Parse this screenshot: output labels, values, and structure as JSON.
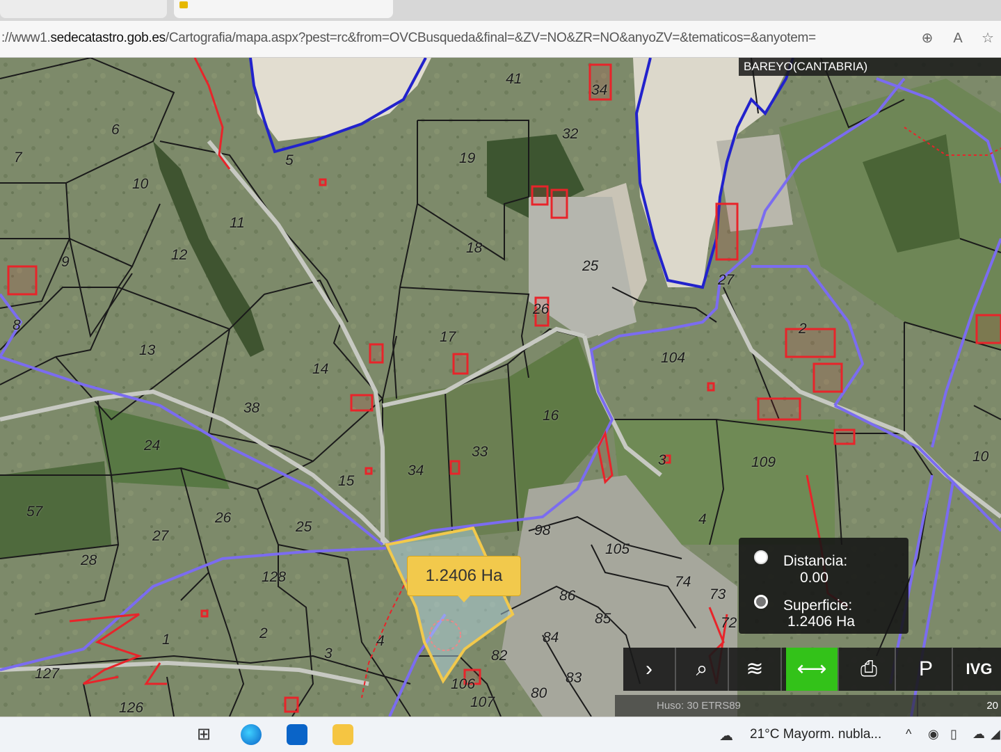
{
  "browser": {
    "url_prefix": "://www1.",
    "url_host": "sedecatastro.gob.es",
    "url_path": "/Cartografia/mapa.aspx?pest=rc&from=OVCBusqueda&final=&ZV=NO&ZR=NO&anyoZV=&tematicos=&anyotem="
  },
  "map": {
    "place_name": "BAREYO(CANTABRIA)",
    "selected_area": "1.2406 Ha",
    "parcels": [
      {
        "id": "p41",
        "text": "41"
      },
      {
        "id": "p34a",
        "text": "34"
      },
      {
        "id": "p6",
        "text": "6"
      },
      {
        "id": "p7",
        "text": "7"
      },
      {
        "id": "p10a",
        "text": "10"
      },
      {
        "id": "p32",
        "text": "32"
      },
      {
        "id": "p19",
        "text": "19"
      },
      {
        "id": "p5",
        "text": "5"
      },
      {
        "id": "p11",
        "text": "11"
      },
      {
        "id": "p12",
        "text": "12"
      },
      {
        "id": "p9",
        "text": "9"
      },
      {
        "id": "p18",
        "text": "18"
      },
      {
        "id": "p25a",
        "text": "25"
      },
      {
        "id": "p8",
        "text": "8"
      },
      {
        "id": "p13",
        "text": "13"
      },
      {
        "id": "p14",
        "text": "14"
      },
      {
        "id": "p17",
        "text": "17"
      },
      {
        "id": "p26a",
        "text": "26"
      },
      {
        "id": "p27a",
        "text": "27"
      },
      {
        "id": "p104",
        "text": "104"
      },
      {
        "id": "p2a",
        "text": "2"
      },
      {
        "id": "p38",
        "text": "38"
      },
      {
        "id": "p16",
        "text": "16"
      },
      {
        "id": "p24",
        "text": "24"
      },
      {
        "id": "p33",
        "text": "33"
      },
      {
        "id": "p34b",
        "text": "34"
      },
      {
        "id": "p15",
        "text": "15"
      },
      {
        "id": "p3a",
        "text": "3"
      },
      {
        "id": "p109",
        "text": "109"
      },
      {
        "id": "p10b",
        "text": "10"
      },
      {
        "id": "p57",
        "text": "57"
      },
      {
        "id": "p26b",
        "text": "26"
      },
      {
        "id": "p25b",
        "text": "25"
      },
      {
        "id": "p98",
        "text": "98"
      },
      {
        "id": "p27b",
        "text": "27"
      },
      {
        "id": "p4a",
        "text": "4"
      },
      {
        "id": "p28",
        "text": "28"
      },
      {
        "id": "p105",
        "text": "105"
      },
      {
        "id": "p128",
        "text": "128"
      },
      {
        "id": "p74",
        "text": "74"
      },
      {
        "id": "p86",
        "text": "86"
      },
      {
        "id": "p73",
        "text": "73"
      },
      {
        "id": "p85",
        "text": "85"
      },
      {
        "id": "p72",
        "text": "72"
      },
      {
        "id": "p1",
        "text": "1"
      },
      {
        "id": "p2b",
        "text": "2"
      },
      {
        "id": "p4b",
        "text": "4"
      },
      {
        "id": "p3b",
        "text": "3"
      },
      {
        "id": "p84",
        "text": "84"
      },
      {
        "id": "p82",
        "text": "82"
      },
      {
        "id": "p127",
        "text": "127"
      },
      {
        "id": "p83",
        "text": "83"
      },
      {
        "id": "p106",
        "text": "106"
      },
      {
        "id": "p107",
        "text": "107"
      },
      {
        "id": "p80",
        "text": "80"
      },
      {
        "id": "p126",
        "text": "126"
      }
    ]
  },
  "measure_panel": {
    "distance_label": "Distancia:",
    "distance_value": "0.00",
    "surface_label": "Superficie:",
    "surface_value": "1.2406 Ha"
  },
  "toolbar": {
    "buttons": [
      {
        "name": "chevron-right",
        "glyph": "›"
      },
      {
        "name": "search",
        "glyph": "⌕"
      },
      {
        "name": "layers",
        "glyph": "≋"
      },
      {
        "name": "measure",
        "glyph": "⟷"
      },
      {
        "name": "print",
        "glyph": "⎙"
      },
      {
        "name": "map-pin",
        "glyph": "P"
      },
      {
        "name": "ivg",
        "glyph": "IVG"
      }
    ]
  },
  "status": {
    "coords_text": "Huso: 30 ETRS89",
    "scale_text": "20"
  },
  "taskbar": {
    "weather": "21°C  Mayorm. nubla...",
    "tray_chevron": "^"
  },
  "colors": {
    "parcel_line": "#1a1a1a",
    "building": "#e8242a",
    "boundary": "#7b6cf0",
    "coast": "#2222cc",
    "selection": "#f2c94c",
    "active_tool": "#33c219"
  }
}
